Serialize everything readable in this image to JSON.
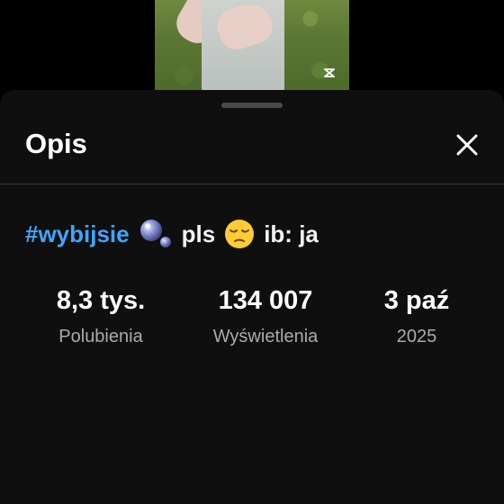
{
  "video_preview": {
    "watermark_icon": "capcut-logo-icon"
  },
  "sheet": {
    "title": "Opis",
    "close_icon": "close-icon"
  },
  "description": {
    "hashtag": "#wybijsie",
    "emoji_1": "bubbles-emoji",
    "text_1": "pls",
    "emoji_2": "pensive-face-emoji",
    "text_2": "ib: ja"
  },
  "stats": [
    {
      "value": "8,3 tys.",
      "label": "Polubienia"
    },
    {
      "value": "134 007",
      "label": "Wyświetlenia"
    },
    {
      "value": "3 paź",
      "label": "2025"
    }
  ],
  "colors": {
    "hashtag": "#3ea6ff",
    "background": "#0f0f0f",
    "secondary_text": "#aaaaaa"
  }
}
